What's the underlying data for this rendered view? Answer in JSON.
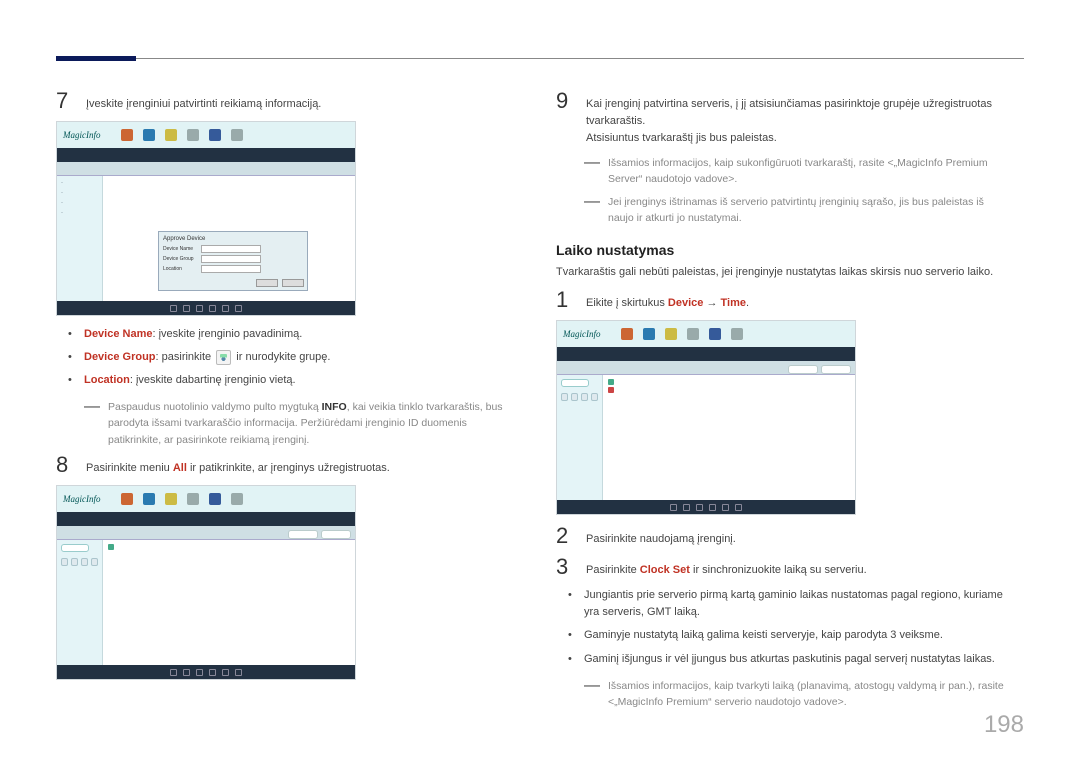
{
  "page": {
    "number": "198"
  },
  "left": {
    "step7": "Įveskite įrenginiui patvirtinti reikiamą informaciją.",
    "bullets": {
      "deviceName": {
        "label": "Device Name",
        "text": ": įveskite įrenginio pavadinimą."
      },
      "deviceGroup": {
        "label": "Device Group",
        "pre": ": pasirinkite ",
        "post": " ir nurodykite grupę."
      },
      "location": {
        "label": "Location",
        "text": ": įveskite dabartinę įrenginio vietą."
      }
    },
    "note7": {
      "pre": "Paspaudus nuotolinio valdymo pulto mygtuką ",
      "bold": "INFO",
      "post": ", kai veikia tinklo tvarkaraštis, bus parodyta išsami tvarkaraščio informacija. Peržiūrėdami įrenginio ID duomenis patikrinkite, ar pasirinkote reikiamą įrenginį."
    },
    "step8": {
      "pre": "Pasirinkite meniu ",
      "all": "All",
      "post": " ir patikrinkite, ar įrenginys užregistruotas."
    }
  },
  "right": {
    "step9": {
      "line1": "Kai įrenginį patvirtina serveris, į jį atsisiunčiamas pasirinktoje grupėje užregistruotas tvarkaraštis.",
      "line2": "Atsisiuntus tvarkaraštį jis bus paleistas."
    },
    "notesA": [
      "Išsamios informacijos, kaip sukonfigūruoti tvarkaraštį, rasite <„MagicInfo Premium Server“ naudotojo vadove>.",
      "Jei įrenginys ištrinamas iš serverio patvirtintų įrenginių sąrašo, jis bus paleistas iš naujo ir atkurti jo nustatymai."
    ],
    "heading": "Laiko nustatymas",
    "intro": "Tvarkaraštis gali nebūti paleistas, jei įrenginyje nustatytas laikas skirsis nuo serverio laiko.",
    "step1": {
      "pre": "Eikite į skirtukus ",
      "device": "Device",
      "arrow": " → ",
      "time": "Time",
      "dot": "."
    },
    "step2": "Pasirinkite naudojamą įrenginį.",
    "step3": {
      "pre": "Pasirinkite ",
      "clockset": "Clock Set",
      "post": " ir sinchronizuokite laiką su serveriu."
    },
    "bullets": [
      "Jungiantis prie serverio pirmą kartą gaminio laikas nustatomas pagal regiono, kuriame yra serveris, GMT laiką.",
      "Gaminyje nustatytą laiką galima keisti serveryje, kaip parodyta 3 veiksme.",
      "Gaminį išjungus ir vėl įjungus bus atkurtas paskutinis pagal serverį nustatytas laikas."
    ],
    "noteB": "Išsamios informacijos, kaip tvarkyti laiką (planavimą, atostogų valdymą ir pan.), rasite <„MagicInfo Premium“ serverio naudotojo vadove>."
  },
  "ss": {
    "logo": "MagicInfo",
    "dialog": {
      "title": "Approve Device",
      "fields": {
        "deviceName": "Device Name",
        "deviceGroup": "Device Group",
        "location": "Location"
      }
    },
    "side8": {
      "pill": " ",
      "i1": " "
    },
    "side9": {
      "i1": " "
    },
    "pills": {
      "a": " ",
      "b": " "
    }
  }
}
